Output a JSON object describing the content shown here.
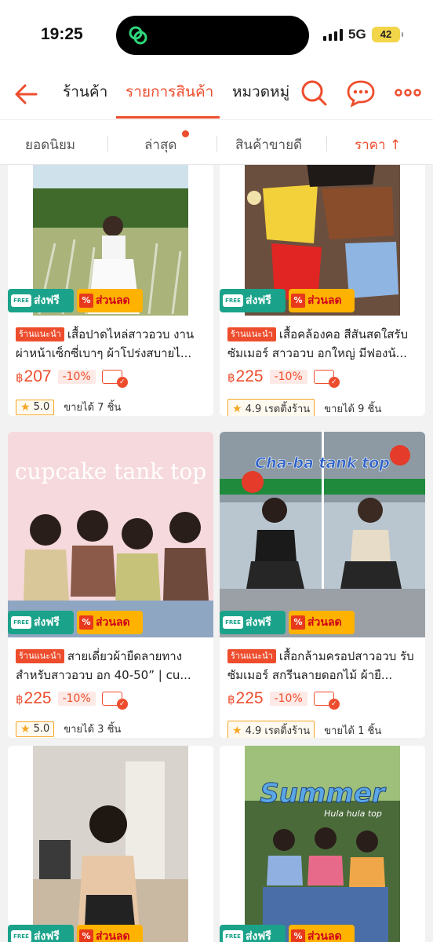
{
  "status": {
    "time": "19:25",
    "network": "5G",
    "battery": "42"
  },
  "nav": {
    "tabs": [
      {
        "label": "ร้านค้า"
      },
      {
        "label": "รายการสินค้า"
      },
      {
        "label": "หมวดหมู่"
      }
    ],
    "active_tab": 1
  },
  "sort": {
    "options": [
      {
        "label": "ยอดนิยม"
      },
      {
        "label": "ล่าสุด"
      },
      {
        "label": "สินค้าขายดี"
      },
      {
        "label": "ราคา ↑"
      }
    ],
    "active": 3
  },
  "badges": {
    "free": "ส่งฟรี",
    "free_truck": "FREE",
    "sale": "ส่วนลด",
    "sale_icon": "%"
  },
  "products": [
    {
      "tag": "ร้านแนะนำ",
      "title": "เสื้อปาดไหล่สาวอวบ งานผ่าหน้าเซ็กซี่เบาๆ ผ้าโปร่งสบายไ...",
      "currency": "฿",
      "price": "207",
      "discount": "-10%",
      "rating": "5.0",
      "sold": "ขายได้ 7 ชิ้น"
    },
    {
      "tag": "ร้านแนะนำ",
      "title": "เสื้อคล้องคอ สีสันสดใสรับซัมเมอร์ สาวอวบ อกใหญ่ มีฟองน้...",
      "currency": "฿",
      "price": "225",
      "discount": "-10%",
      "rating": "4.9 เรตติ้งร้าน",
      "sold": "ขายได้ 9 ชิ้น"
    },
    {
      "tag": "ร้านแนะนำ",
      "title": "สายเดี่ยวผ้ายืดลายทาง สำหรับสาวอวบ อก 40-50” | cu...",
      "currency": "฿",
      "price": "225",
      "discount": "-10%",
      "rating": "5.0",
      "sold": "ขายได้ 3 ชิ้น",
      "image_text": "cupcake tank top"
    },
    {
      "tag": "ร้านแนะนำ",
      "title": "เสื้อกล้ามครอปสาวอวบ รับซัมเมอร์ สกรีนลายดอกไม้ ผ้ายื...",
      "currency": "฿",
      "price": "225",
      "discount": "-10%",
      "rating": "4.9 เรตติ้งร้าน",
      "sold": "ขายได้ 1 ชิ้น",
      "image_text": "Cha-ba tank top"
    },
    {
      "image_text": ""
    },
    {
      "image_text": "Summer",
      "image_subtext": "Hula hula top"
    }
  ],
  "colors": {
    "accent": "#ee4d2d",
    "free_badge": "#1aa38a",
    "sale_badge": "#ffb300"
  }
}
